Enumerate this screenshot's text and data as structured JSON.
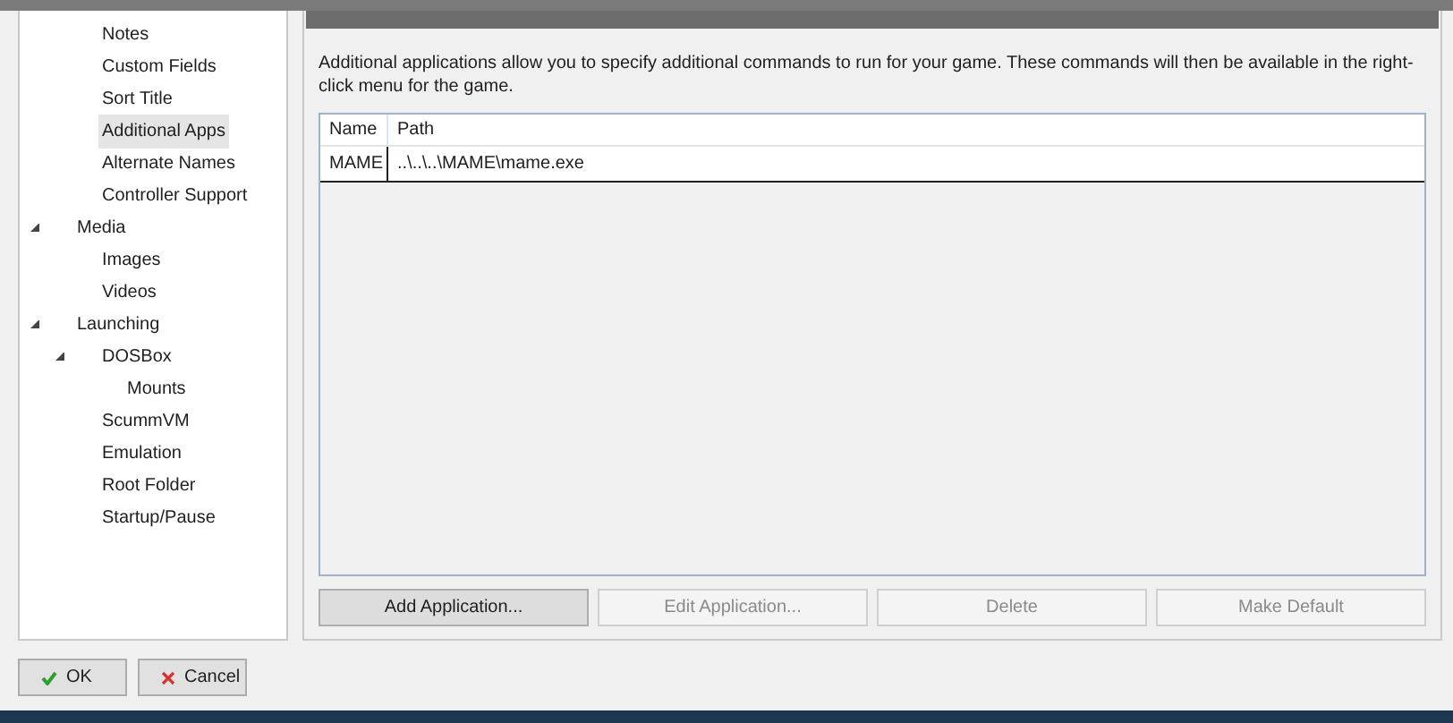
{
  "tree": {
    "items_of_hidden_parent": [
      {
        "label": "Notes",
        "selected": false
      },
      {
        "label": "Custom Fields",
        "selected": false
      },
      {
        "label": "Sort Title",
        "selected": false
      },
      {
        "label": "Additional Apps",
        "selected": true
      },
      {
        "label": "Alternate Names",
        "selected": false
      },
      {
        "label": "Controller Support",
        "selected": false
      }
    ],
    "nodes": [
      {
        "label": "Media",
        "selected": false,
        "expanded": true,
        "children": [
          {
            "label": "Images",
            "selected": false
          },
          {
            "label": "Videos",
            "selected": false
          }
        ]
      },
      {
        "label": "Launching",
        "selected": false,
        "expanded": true,
        "children": [
          {
            "label": "DOSBox",
            "selected": false,
            "expanded": true,
            "children": [
              {
                "label": "Mounts",
                "selected": false
              }
            ]
          },
          {
            "label": "ScummVM",
            "selected": false
          },
          {
            "label": "Emulation",
            "selected": false
          },
          {
            "label": "Root Folder",
            "selected": false
          },
          {
            "label": "Startup/Pause",
            "selected": false
          }
        ]
      }
    ]
  },
  "panel": {
    "description": "Additional applications allow you to specify additional commands to run for your game.  These commands will then be available in the right-click menu for the game.",
    "table": {
      "columns": [
        "Name",
        "Path"
      ],
      "rows": [
        [
          "MAME",
          "..\\..\\..\\MAME\\mame.exe"
        ]
      ]
    },
    "buttons": [
      {
        "label": "Add Application...",
        "disabled": false
      },
      {
        "label": "Edit Application...",
        "disabled": true
      },
      {
        "label": "Delete",
        "disabled": true
      },
      {
        "label": "Make Default",
        "disabled": true
      }
    ]
  },
  "dialog_buttons": [
    {
      "label": "OK",
      "kind": "ok"
    },
    {
      "label": "Cancel",
      "kind": "cancel"
    }
  ]
}
